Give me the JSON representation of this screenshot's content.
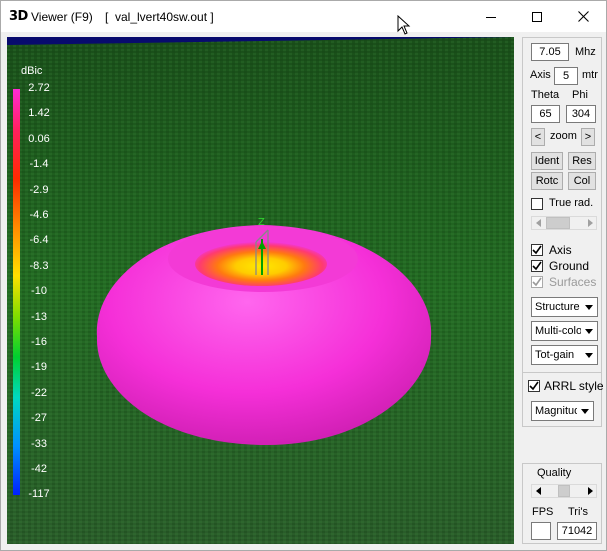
{
  "window": {
    "app_icon": "3D",
    "title": "Viewer (F9)",
    "file": "[  val_lvert40sw.out ]",
    "buttons": [
      "minimize-icon",
      "maximize-icon",
      "close-icon"
    ]
  },
  "view": {
    "scale_unit": "dBic",
    "scale_labels": [
      "2.72",
      "1.42",
      "0.06",
      "-1.4",
      "-2.9",
      "-4.6",
      "-6.4",
      "-8.3",
      "-10",
      "-13",
      "-16",
      "-19",
      "-22",
      "-27",
      "-33",
      "-42",
      "-117"
    ],
    "pattern_color": "#ff2bd4",
    "ground_color": "#1f6b1f",
    "sky_color": "#080b6e",
    "axis_label": "Z"
  },
  "panel": {
    "freq_value": "7.05",
    "freq_unit": "Mhz",
    "axis_label": "Axis",
    "axis_value": "5",
    "axis_unit": "mtr",
    "theta_label": "Theta",
    "phi_label": "Phi",
    "theta_value": "65",
    "phi_value": "304",
    "zoom_left": "<",
    "zoom_label": "zoom",
    "zoom_right": ">",
    "ident": "Ident",
    "res": "Res",
    "rotc": "Rotc",
    "col": "Col",
    "true_rad": {
      "label": "True rad.",
      "checked": false
    },
    "axis_chk": {
      "label": "Axis",
      "checked": true
    },
    "ground_chk": {
      "label": "Ground",
      "checked": true
    },
    "surfaces_chk": {
      "label": "Surfaces",
      "checked": true,
      "disabled": true
    },
    "structure_select": "Structure",
    "color_select": "Multi-colo",
    "gain_select": "Tot-gain",
    "arrl_chk": {
      "label": "ARRL style",
      "checked": true
    },
    "magnitude_select": "Magnitud"
  },
  "panel2": {
    "quality_label": "Quality",
    "fps_label": "FPS",
    "tris_label": "Tri's",
    "fps_value": "",
    "tris_value": "71042"
  }
}
